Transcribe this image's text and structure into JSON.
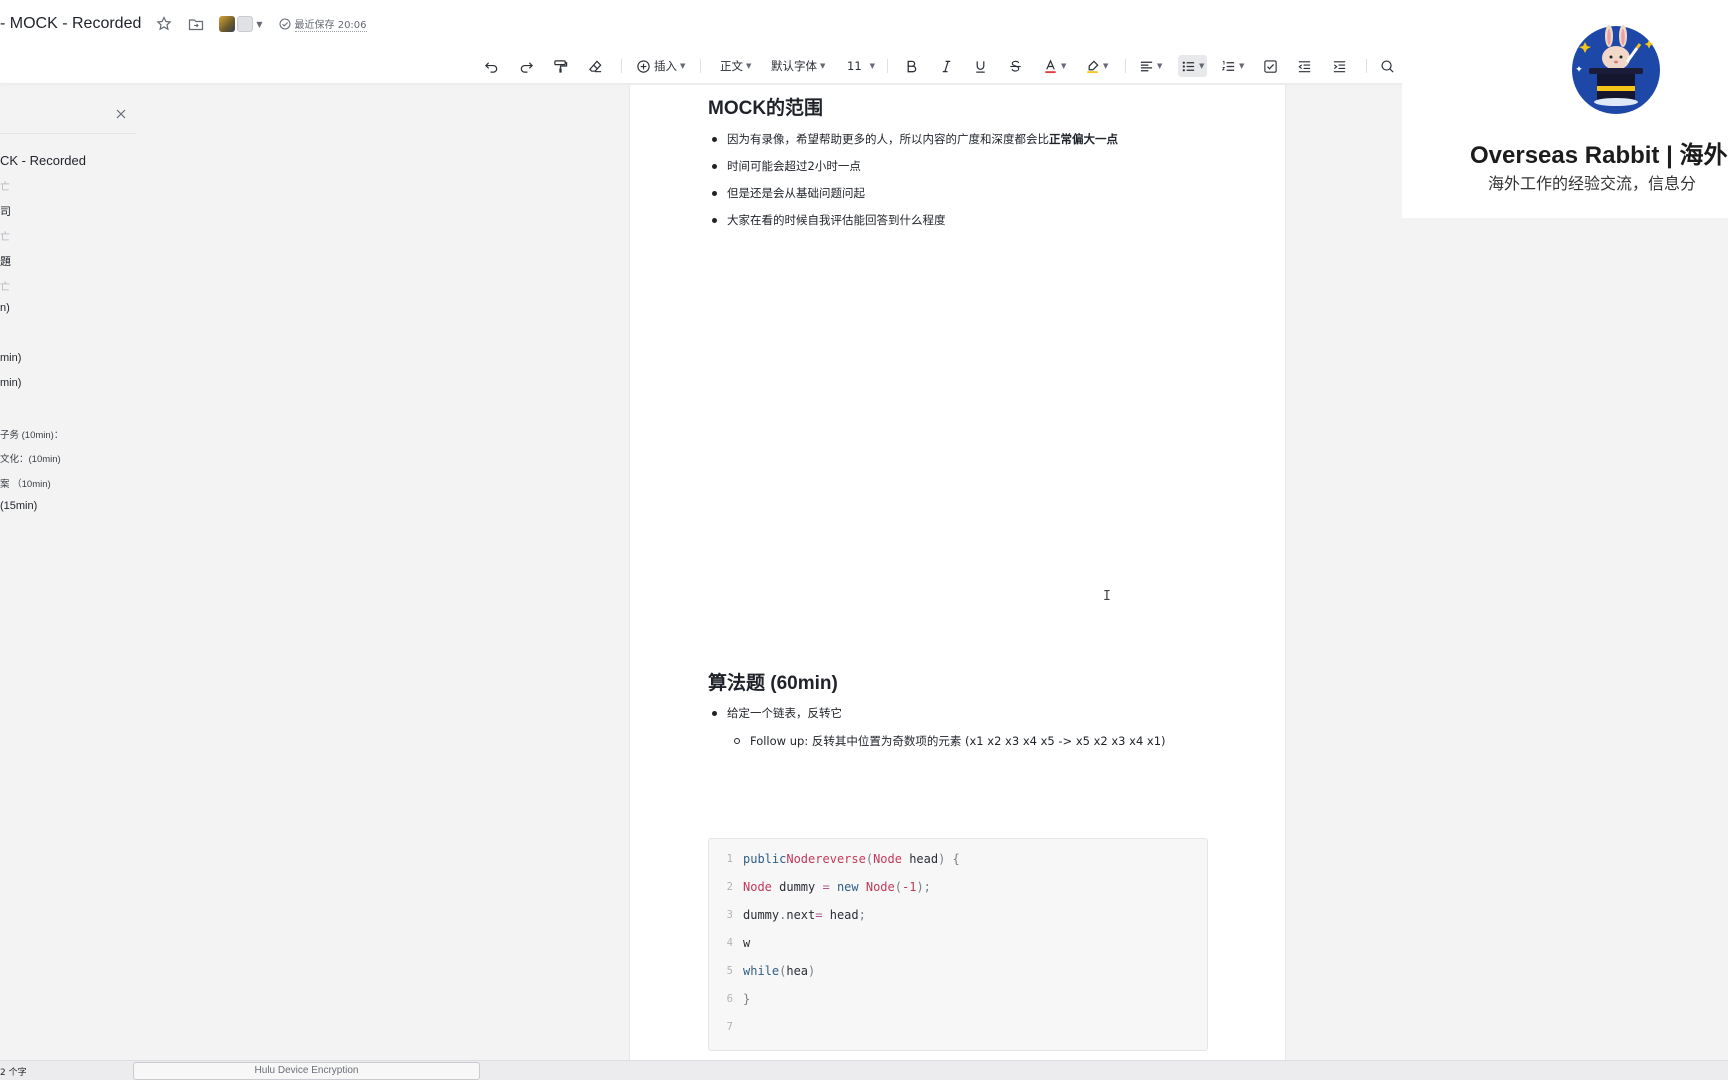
{
  "header": {
    "doc_title": "- MOCK - Recorded",
    "save_status": "最近保存 20:06"
  },
  "toolbar": {
    "insert_label": "插入",
    "style_label": "正文",
    "font_label": "默认字体",
    "size_label": "11"
  },
  "sidebar": {
    "title": "CK - Recorded",
    "items": [
      {
        "text": "亡",
        "kind": "faint"
      },
      {
        "text": "司",
        "kind": "normal"
      },
      {
        "text": "亡",
        "kind": "faint"
      },
      {
        "text": "題",
        "kind": "normal"
      },
      {
        "text": "亡",
        "kind": "faint"
      },
      {
        "text": "n)",
        "kind": "normal"
      },
      {
        "text": "min)",
        "kind": "normal"
      },
      {
        "text": " min)",
        "kind": "normal"
      },
      {
        "text": "子务 (10min)：",
        "kind": "small"
      },
      {
        "text": "文化：(10min)",
        "kind": "small"
      },
      {
        "text": "案 （10min)",
        "kind": "small"
      },
      {
        "text": "(15min)",
        "kind": "normal"
      }
    ]
  },
  "document": {
    "section1": {
      "heading": "MOCK的范围",
      "bullets": [
        {
          "text": "因为有录像，希望帮助更多的人，所以内容的广度和深度都会比",
          "bold": "正常偏大一点"
        },
        {
          "text": "时间可能会超过2小时一点",
          "bold": ""
        },
        {
          "text": "但是还是会从基础问题问起",
          "bold": ""
        },
        {
          "text": "大家在看的时候自我评估能回答到什么程度",
          "bold": ""
        }
      ]
    },
    "section2": {
      "heading": "算法题 (60min)",
      "bullet": "给定一个链表，反转它",
      "sub_bullet": "Follow up: 反转其中位置为奇数项的元素 (x1 x2 x3 x4 x5 -> x5 x2 x3 x4 x1)"
    },
    "code": {
      "line_numbers": [
        "1",
        "2",
        "3",
        "4",
        "5",
        "6",
        "7"
      ],
      "l1": {
        "kw": "public",
        "type": "Node",
        "fn": "reverse",
        "p1": "(",
        "ptype": "Node",
        "param": " head",
        "p2": ") {"
      },
      "l2": {
        "type": "Node",
        "var": " dummy ",
        "op": "=",
        "kw": " new ",
        "ctor": "Node",
        "p1": "(",
        "num": "-1",
        "p2": ");"
      },
      "l3": {
        "a": "dummy",
        "dot": ".",
        "b": "next",
        "op": "=",
        "c": " head",
        "semi": ";"
      },
      "l4": {
        "text": "w"
      },
      "l5": {
        "kw": "while",
        "p1": "(",
        "arg": "hea",
        "p2": ")"
      },
      "l6": {
        "text": "}"
      }
    }
  },
  "overlay": {
    "title": "Overseas Rabbit | 海外",
    "subtitle": "海外工作的经验交流，信息分"
  },
  "statusbar": {
    "word_count": "2 个字",
    "task_button": "Hulu Device Encryption"
  },
  "colors": {
    "accent_underline_font": "#e03e3e",
    "code_keyword": "#2f5f86",
    "code_type": "#c03a5b",
    "logo_blue": "#1e48a8"
  }
}
